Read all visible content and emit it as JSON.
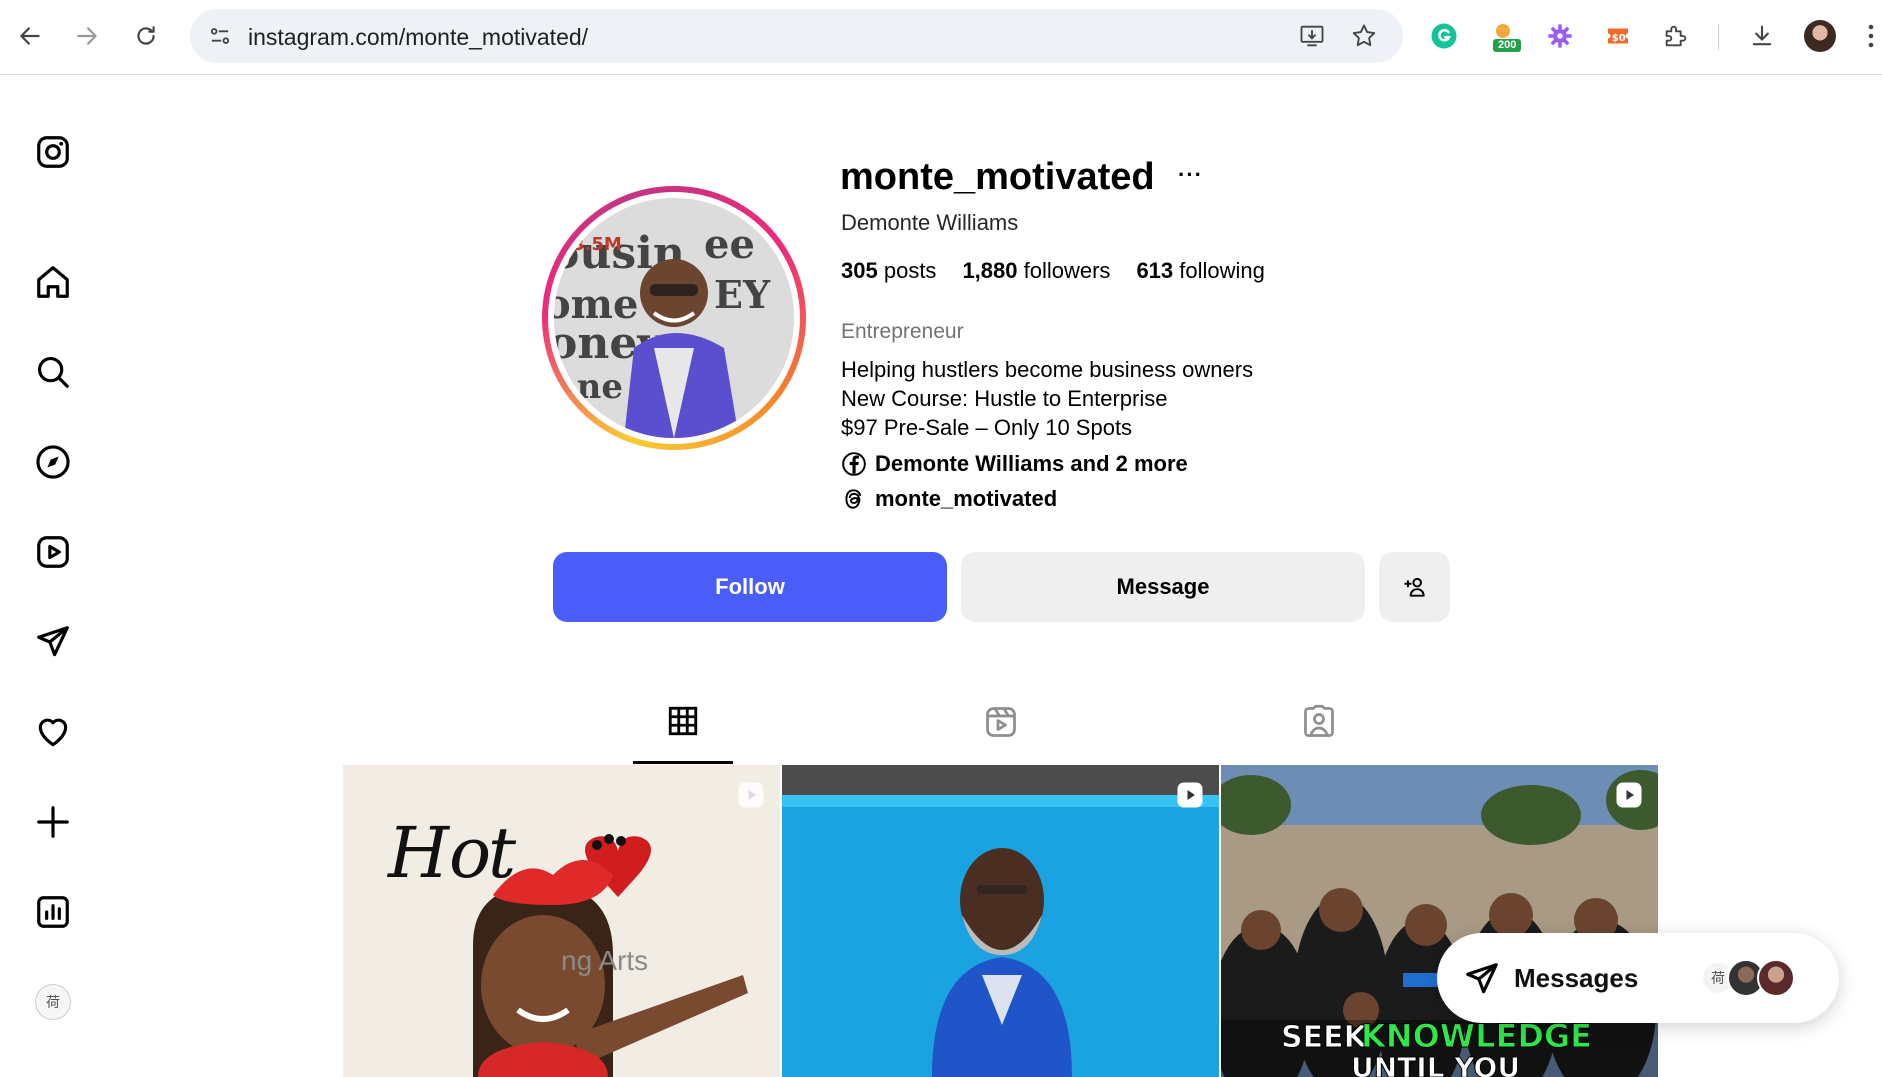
{
  "browser": {
    "url": "instagram.com/monte_motivated/",
    "extension_badge": "200"
  },
  "profile": {
    "username": "monte_motivated",
    "full_name": "Demonte Williams",
    "posts_count": "305",
    "posts_label": "posts",
    "followers_count": "1,880",
    "followers_label": "followers",
    "following_count": "613",
    "following_label": "following",
    "category": "Entrepreneur",
    "bio_lines": [
      "Helping hustlers become business owners",
      "New Course: Hustle to Enterprise",
      "$97 Pre-Sale – Only 10 Spots"
    ],
    "facebook_link": "Demonte Williams and 2 more",
    "threads_link": "monte_motivated"
  },
  "actions": {
    "follow_label": "Follow",
    "message_label": "Message"
  },
  "posts": [
    {
      "caption_fragment": "ng Arts",
      "type": "reel"
    },
    {
      "caption_fragment": "",
      "type": "reel"
    },
    {
      "caption_fragment": "SEEK KNOWLEDGE",
      "caption_fragment_2": "UNTIL YOU",
      "type": "reel"
    }
  ],
  "messages_widget": {
    "label": "Messages"
  },
  "colors": {
    "follow_button": "#4a5df9",
    "secondary_button": "#efefef",
    "muted_text": "#737373",
    "seek_text_green": "#2ee84a"
  }
}
